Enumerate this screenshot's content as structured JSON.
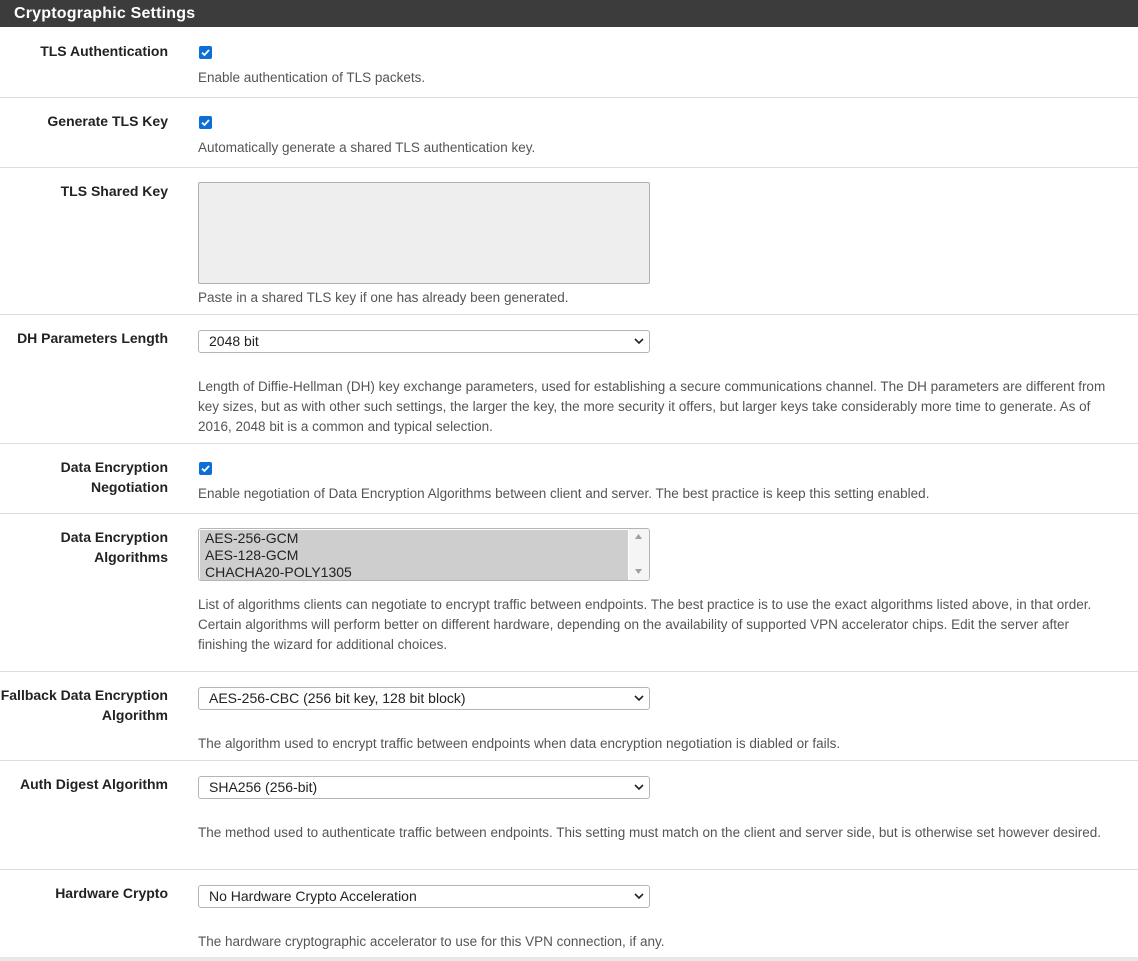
{
  "panel": {
    "title": "Cryptographic Settings"
  },
  "tls_auth": {
    "label": "TLS Authentication",
    "checked": true,
    "help": "Enable authentication of TLS packets."
  },
  "gen_tls_key": {
    "label": "Generate TLS Key",
    "checked": true,
    "help": "Automatically generate a shared TLS authentication key."
  },
  "tls_shared_key": {
    "label": "TLS Shared Key",
    "value": "",
    "help": "Paste in a shared TLS key if one has already been generated."
  },
  "dh_length": {
    "label": "DH Parameters Length",
    "selected": "2048 bit",
    "help": "Length of Diffie-Hellman (DH) key exchange parameters, used for establishing a secure communications channel. The DH parameters are different from key sizes, but as with other such settings, the larger the key, the more security it offers, but larger keys take considerably more time to generate. As of 2016, 2048 bit is a common and typical selection."
  },
  "data_enc_neg": {
    "label_line1": "Data Encryption",
    "label_line2": "Negotiation",
    "checked": true,
    "help": "Enable negotiation of Data Encryption Algorithms between client and server. The best practice is keep this setting enabled."
  },
  "data_enc_algos": {
    "label_line1": "Data Encryption",
    "label_line2": "Algorithms",
    "options": [
      "AES-256-GCM",
      "AES-128-GCM",
      "CHACHA20-POLY1305"
    ],
    "help": "List of algorithms clients can negotiate to encrypt traffic between endpoints. The best practice is to use the exact algorithms listed above, in that order. Certain algorithms will perform better on different hardware, depending on the availability of supported VPN accelerator chips. Edit the server after finishing the wizard for additional choices."
  },
  "fallback_algo": {
    "label_line1": "Fallback Data Encryption",
    "label_line2": "Algorithm",
    "selected": "AES-256-CBC (256 bit key, 128 bit block)",
    "help": "The algorithm used to encrypt traffic between endpoints when data encryption negotiation is diabled or fails."
  },
  "auth_digest": {
    "label": "Auth Digest Algorithm",
    "selected": "SHA256 (256-bit)",
    "help": "The method used to authenticate traffic between endpoints. This setting must match on the client and server side, but is otherwise set however desired."
  },
  "hw_crypto": {
    "label": "Hardware Crypto",
    "selected": "No Hardware Crypto Acceleration",
    "help": "The hardware cryptographic accelerator to use for this VPN connection, if any."
  },
  "colors": {
    "header_bg": "#3c3c3c",
    "checkbox": "#0b6fd6",
    "textarea_bg": "#eeeeee",
    "multiselect_highlight": "#cecece"
  },
  "icons": {
    "checkbox_check": "check-icon",
    "select_arrow": "chevron-down-icon",
    "resize": "resize-grip-icon",
    "scroll_up": "scroll-up-arrow-icon",
    "scroll_down": "scroll-down-arrow-icon"
  }
}
